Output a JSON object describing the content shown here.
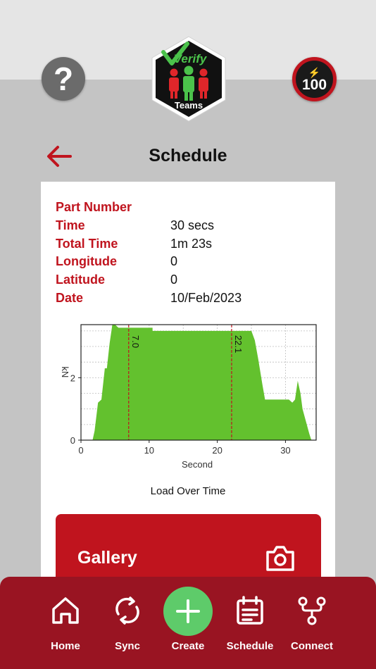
{
  "header": {
    "help_glyph": "?",
    "logo": {
      "word": "Verify",
      "subtitle": "Teams"
    },
    "score": {
      "bolt_glyph": "⚡",
      "value": "100"
    }
  },
  "page": {
    "title": "Schedule"
  },
  "details": [
    {
      "label": "Part Number",
      "value": ""
    },
    {
      "label": "Time",
      "value": "30 secs"
    },
    {
      "label": "Total Time",
      "value": "1m 23s"
    },
    {
      "label": "Longitude",
      "value": "0"
    },
    {
      "label": "Latitude",
      "value": "0"
    },
    {
      "label": "Date",
      "value": "10/Feb/2023"
    }
  ],
  "chart_data": {
    "type": "area",
    "title": "Load Over Time",
    "xlabel": "Second",
    "ylabel": "kN",
    "xlim": [
      0,
      34.5
    ],
    "ylim": [
      0,
      3.7
    ],
    "xticks": [
      0,
      10,
      20,
      30
    ],
    "yticks": [
      0,
      2
    ],
    "grid": true,
    "fill_color": "#63c12e",
    "marker_color": "#c0141e",
    "markers": [
      {
        "x": 7.0,
        "label": "7.0"
      },
      {
        "x": 22.1,
        "label": "22.1"
      }
    ],
    "x": [
      1.7,
      2.0,
      2.5,
      3.0,
      3.5,
      3.8,
      4.2,
      4.6,
      5.0,
      5.5,
      6.5,
      7.0,
      8.0,
      10.5,
      10.5,
      13.5,
      17.0,
      22.0,
      25.0,
      25.5,
      26.0,
      26.6,
      27.0,
      27.5,
      29.5,
      30.5,
      31.0,
      31.4,
      31.8,
      32.2,
      32.5,
      33.0,
      33.5,
      33.8
    ],
    "y": [
      0.0,
      0.3,
      1.2,
      1.3,
      2.3,
      2.3,
      3.1,
      3.7,
      3.7,
      3.6,
      3.6,
      3.6,
      3.6,
      3.6,
      3.5,
      3.5,
      3.5,
      3.5,
      3.5,
      3.2,
      2.6,
      1.8,
      1.3,
      1.3,
      1.3,
      1.3,
      1.2,
      1.3,
      1.9,
      1.5,
      1.0,
      0.6,
      0.2,
      0.0
    ]
  },
  "gallery": {
    "label": "Gallery",
    "icon": "camera-icon"
  },
  "nav": [
    {
      "label": "Home",
      "icon": "home-icon"
    },
    {
      "label": "Sync",
      "icon": "sync-icon"
    },
    {
      "label": "Create",
      "icon": "plus-icon"
    },
    {
      "label": "Schedule",
      "icon": "schedule-icon"
    },
    {
      "label": "Connect",
      "icon": "connect-icon"
    }
  ],
  "colors": {
    "brand_red": "#c0141e",
    "nav_red": "#991422",
    "create_green": "#5ecb6a",
    "chart_green": "#63c12e"
  }
}
